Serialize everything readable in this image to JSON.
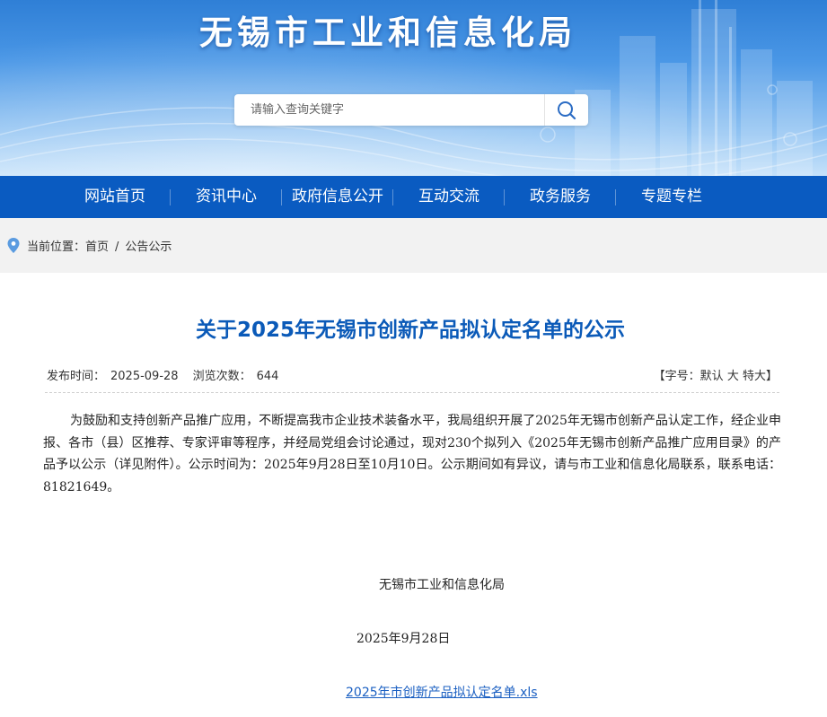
{
  "header": {
    "site_title": "无锡市工业和信息化局",
    "search": {
      "placeholder": "请输入查询关键字"
    }
  },
  "nav": {
    "items": [
      "网站首页",
      "资讯中心",
      "政府信息公开",
      "互动交流",
      "政务服务",
      "专题专栏"
    ]
  },
  "breadcrumb": {
    "prefix": "当前位置：",
    "items": [
      "首页",
      "公告公示"
    ],
    "separator": "/"
  },
  "article": {
    "title": "关于2025年无锡市创新产品拟认定名单的公示",
    "publish_label": "发布时间：",
    "publish_date": "2025-09-28",
    "views_label": "浏览次数：",
    "views": "644",
    "font_size": {
      "open": "【字号：",
      "default": "默认",
      "large": "大",
      "xlarge": "特大",
      "close": "】"
    },
    "body": "为鼓励和支持创新产品推广应用，不断提高我市企业技术装备水平，我局组织开展了2025年无锡市创新产品认定工作，经企业申报、各市（县）区推荐、专家评审等程序，并经局党组会讨论通过，现对230个拟列入《2025年无锡市创新产品推广应用目录》的产品予以公示（详见附件）。公示时间为：2025年9月28日至10月10日。公示期间如有异议，请与市工业和信息化局联系，联系电话：81821649。",
    "signature_org": "无锡市工业和信息化局",
    "signature_date": "2025年9月28日",
    "attachment": "2025年市创新产品拟认定名单.xls"
  },
  "colors": {
    "nav_bg": "#0a5bc1",
    "title_blue": "#0b5ab8",
    "link_blue": "#1a5fc2",
    "breadcrumb_bg": "#f2f2f2"
  }
}
